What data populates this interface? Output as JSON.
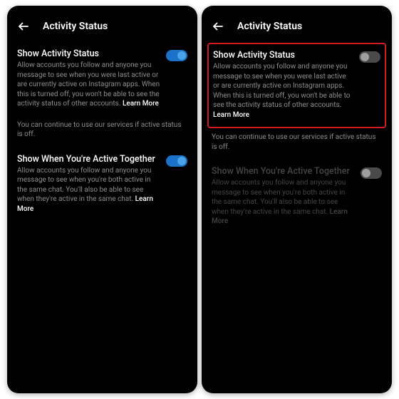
{
  "left": {
    "title": "Activity Status",
    "activity": {
      "title": "Show Activity Status",
      "desc": "Allow accounts you follow and anyone you message to see when you were last active or are currently active on Instagram apps. When this is turned off, you won't be able to see the activity status of other accounts.",
      "learnMore": "Learn More",
      "toggleOn": true
    },
    "info": "You can continue to use our services if active status is off.",
    "together": {
      "title": "Show When You're Active Together",
      "desc": "Allow accounts you follow and anyone you message to see when you're both active in the same chat. You'll also be able to see when they're active in the same chat.",
      "learnMore": "Learn More",
      "toggleOn": true,
      "disabled": false
    }
  },
  "right": {
    "title": "Activity Status",
    "activity": {
      "title": "Show Activity Status",
      "desc": "Allow accounts you follow and anyone you message to see when you were last active or are currently active on Instagram apps. When this is turned off, you won't be able to see the activity status of other accounts.",
      "learnMore": "Learn More",
      "toggleOn": false
    },
    "info": "You can continue to use our services if active status is off.",
    "together": {
      "title": "Show When You're Active Together",
      "desc": "Allow accounts you follow and anyone you message to see when you're both active in the same chat. You'll also be able to see when they're active in the same chat.",
      "learnMore": "Learn More",
      "toggleOn": false,
      "disabled": true
    }
  }
}
